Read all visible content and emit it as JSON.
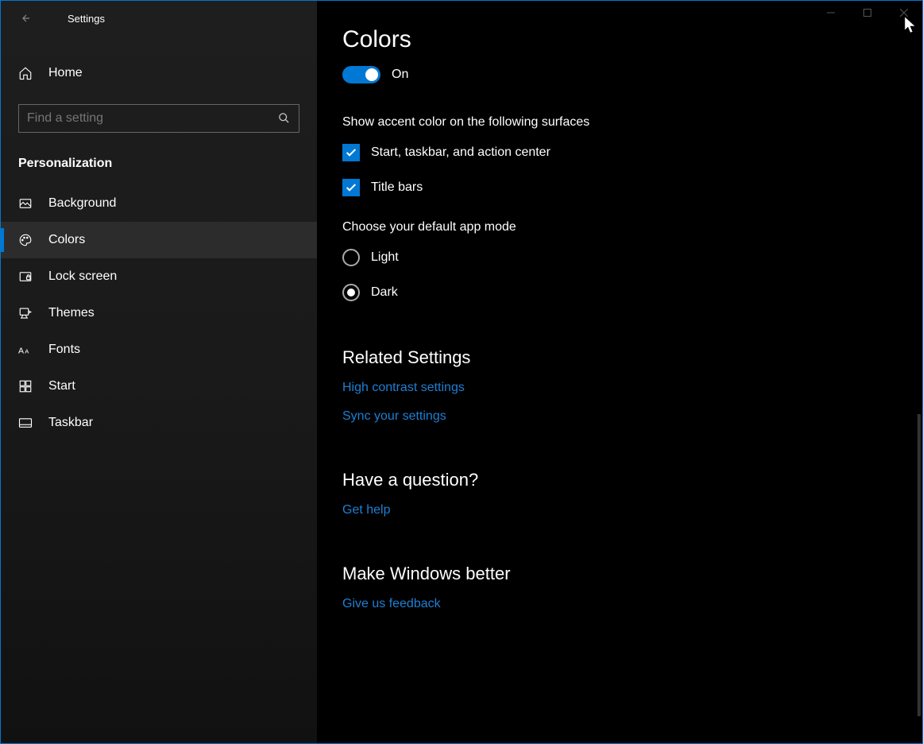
{
  "app": {
    "title": "Settings"
  },
  "sidebar": {
    "home_label": "Home",
    "search_placeholder": "Find a setting",
    "section_title": "Personalization",
    "items": [
      {
        "label": "Background",
        "icon": "picture-icon",
        "active": false
      },
      {
        "label": "Colors",
        "icon": "palette-icon",
        "active": true
      },
      {
        "label": "Lock screen",
        "icon": "lock-picture-icon",
        "active": false
      },
      {
        "label": "Themes",
        "icon": "brush-icon",
        "active": false
      },
      {
        "label": "Fonts",
        "icon": "font-icon",
        "active": false
      },
      {
        "label": "Start",
        "icon": "grid-icon",
        "active": false
      },
      {
        "label": "Taskbar",
        "icon": "taskbar-icon",
        "active": false
      }
    ]
  },
  "main": {
    "page_title": "Colors",
    "toggle": {
      "state_label": "On",
      "on": true
    },
    "accent_surfaces": {
      "heading": "Show accent color on the following surfaces",
      "options": [
        {
          "label": "Start, taskbar, and action center",
          "checked": true
        },
        {
          "label": "Title bars",
          "checked": true
        }
      ]
    },
    "app_mode": {
      "heading": "Choose your default app mode",
      "options": [
        {
          "label": "Light",
          "selected": false
        },
        {
          "label": "Dark",
          "selected": true
        }
      ]
    },
    "related": {
      "title": "Related Settings",
      "links": [
        {
          "label": "High contrast settings"
        },
        {
          "label": "Sync your settings"
        }
      ]
    },
    "question": {
      "title": "Have a question?",
      "link": "Get help"
    },
    "better": {
      "title": "Make Windows better",
      "link": "Give us feedback"
    }
  },
  "colors": {
    "accent": "#0078d4",
    "link": "#1f7fd4"
  }
}
